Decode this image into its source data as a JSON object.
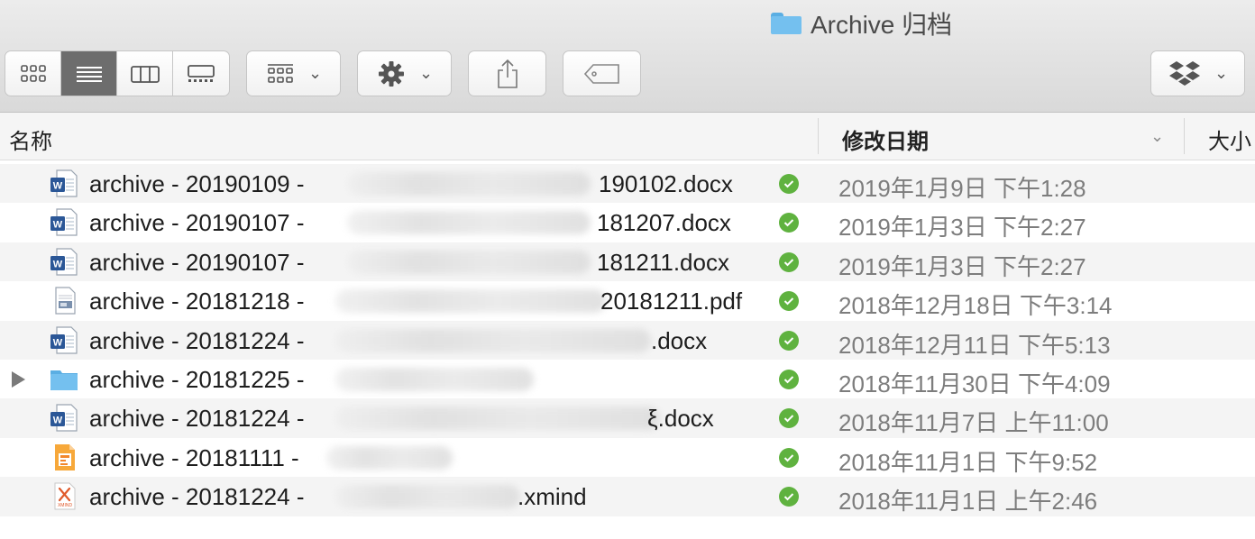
{
  "window": {
    "title": "Archive 归档"
  },
  "toolbar": {
    "view_modes": [
      "icon-view",
      "list-view",
      "column-view",
      "gallery-view"
    ],
    "active_view": "list-view",
    "group_button": "group-icon",
    "action_button": "gear-icon",
    "share_button": "share-icon",
    "tag_button": "tag-icon",
    "dropbox_button": "dropbox-icon"
  },
  "columns": {
    "name": "名称",
    "date": "修改日期",
    "size": "大小"
  },
  "rows": [
    {
      "type": "word",
      "prefix": "archive - 20190109 - ",
      "suffix": "190102.docx",
      "date": "2019年1月9日 下午1:28",
      "sync": "synced"
    },
    {
      "type": "word",
      "prefix": "archive - 20190107 - ",
      "suffix": "181207.docx",
      "date": "2019年1月3日 下午2:27",
      "sync": "synced"
    },
    {
      "type": "word",
      "prefix": "archive - 20190107 - ",
      "suffix": "181211.docx",
      "date": "2019年1月3日 下午2:27",
      "sync": "synced"
    },
    {
      "type": "pdf",
      "prefix": "archive - 20181218 - ",
      "suffix": "20181211.pdf",
      "date": "2018年12月18日 下午3:14",
      "sync": "synced"
    },
    {
      "type": "word",
      "prefix": "archive - 20181224 - ",
      "suffix": ".docx",
      "date": "2018年12月11日 下午5:13",
      "sync": "synced"
    },
    {
      "type": "folder",
      "prefix": "archive - 20181225 - ",
      "suffix": "",
      "date": "2018年11月30日 下午4:09",
      "sync": "synced"
    },
    {
      "type": "word",
      "prefix": "archive - 20181224 - ",
      "suffix": "ξ.docx",
      "date": "2018年11月7日 上午11:00",
      "sync": "synced"
    },
    {
      "type": "slides",
      "prefix": "archive - 20181111 - ",
      "suffix": "",
      "date": "2018年11月1日 下午9:52",
      "sync": "synced"
    },
    {
      "type": "xmind",
      "prefix": "archive - 20181224 - ",
      "suffix": ".xmind",
      "date": "2018年11月1日 上午2:46",
      "sync": "synced"
    }
  ],
  "colors": {
    "sync_green": "#5fb23f",
    "folder_blue": "#74c0ef",
    "word_blue": "#2b5797"
  }
}
